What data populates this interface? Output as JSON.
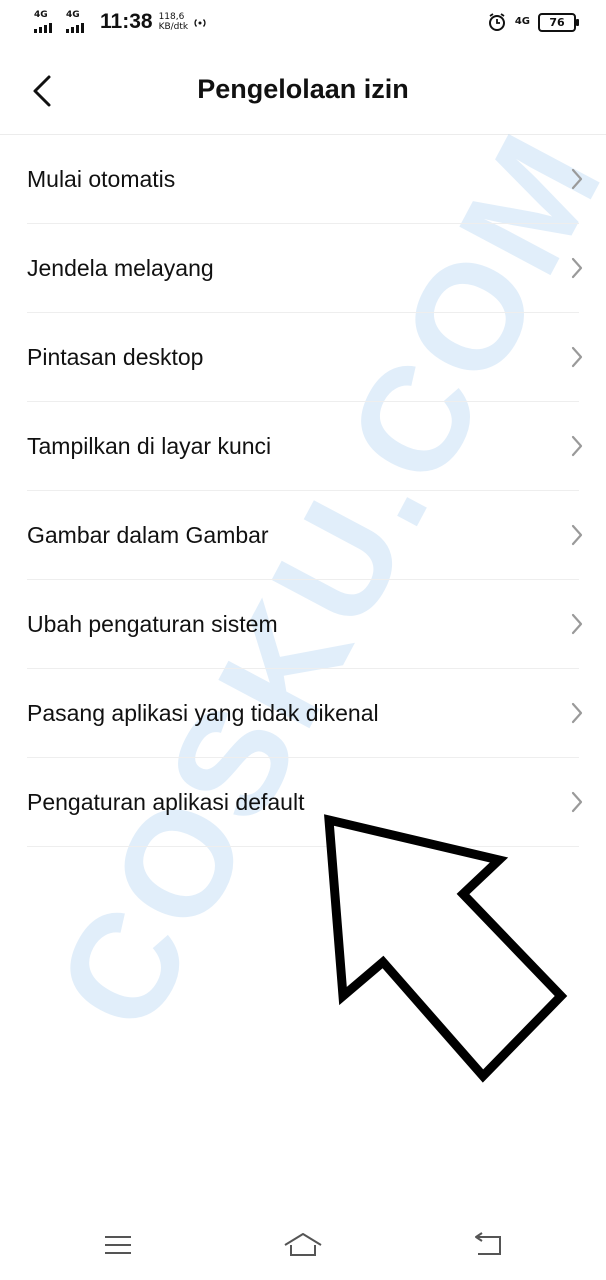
{
  "status_bar": {
    "sim1_network": "4G",
    "sim2_network": "4G",
    "time": "11:38",
    "speed_value": "118,6",
    "speed_unit": "KB/dtk",
    "right_network": "4G",
    "battery_level": "76"
  },
  "header": {
    "title": "Pengelolaan izin"
  },
  "list": {
    "items": [
      {
        "label": "Mulai otomatis"
      },
      {
        "label": "Jendela melayang"
      },
      {
        "label": "Pintasan desktop"
      },
      {
        "label": "Tampilkan di layar kunci"
      },
      {
        "label": "Gambar dalam Gambar"
      },
      {
        "label": "Ubah pengaturan sistem"
      },
      {
        "label": "Pasang aplikasi yang tidak dikenal"
      },
      {
        "label": "Pengaturan aplikasi default"
      }
    ]
  },
  "watermark": {
    "text": "COSKU.COM"
  },
  "icons": {
    "back": "chevron-left-icon",
    "item_arrow": "chevron-right-icon",
    "nav_menu": "menu-icon",
    "nav_home": "home-icon",
    "nav_back": "back-icon"
  }
}
